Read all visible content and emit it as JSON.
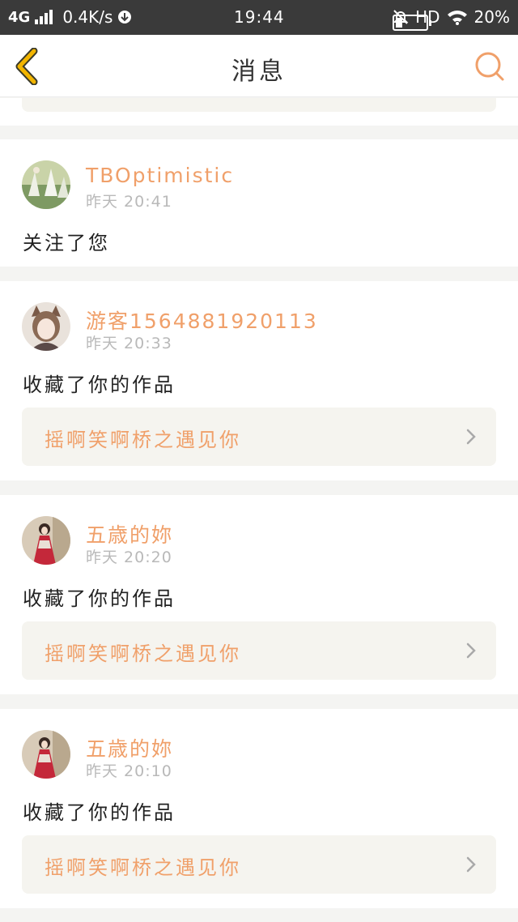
{
  "status_bar": {
    "network": "4G",
    "speed": "0.4K/s",
    "time": "19:44",
    "hd": "HD",
    "battery": "20%"
  },
  "header": {
    "title": "消息",
    "back_icon": "chevron-left-icon",
    "search_icon": "search-icon"
  },
  "colors": {
    "accent": "#f0a06a",
    "back_icon": "#f2b500",
    "work_box_bg": "#f5f4ef",
    "page_bg": "#f4f4f2",
    "status_bar_bg": "#3a3a3a"
  },
  "notifications": [
    {
      "username": "TBOptimistic",
      "time": "昨天 20:41",
      "action": "关注了您"
    },
    {
      "username": "游客1564881920113",
      "time": "昨天 20:33",
      "action": "收藏了你的作品",
      "work": "摇啊笑啊桥之遇见你"
    },
    {
      "username": "五歳的妳",
      "time": "昨天 20:20",
      "action": "收藏了你的作品",
      "work": "摇啊笑啊桥之遇见你"
    },
    {
      "username": "五歳的妳",
      "time": "昨天 20:10",
      "action": "收藏了你的作品",
      "work": "摇啊笑啊桥之遇见你"
    }
  ]
}
